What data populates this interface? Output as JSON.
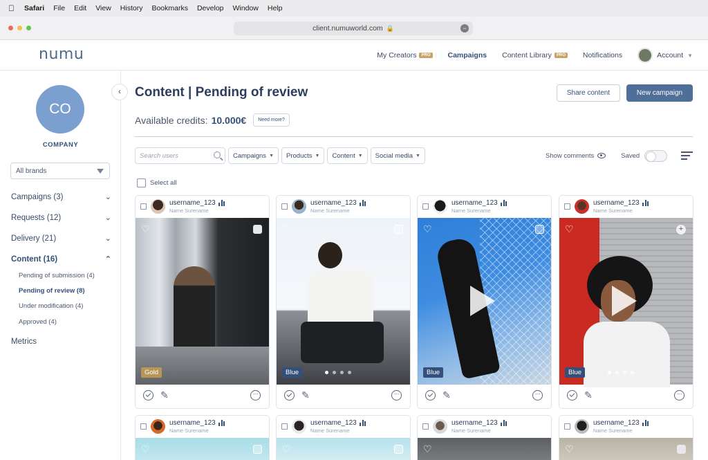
{
  "mac_menu": [
    "Safari",
    "File",
    "Edit",
    "View",
    "History",
    "Bookmarks",
    "Develop",
    "Window",
    "Help"
  ],
  "browser": {
    "url": "client.numuworld.com"
  },
  "nav": {
    "logo": "numu",
    "links": [
      {
        "label": "My Creators",
        "badge": "PRO"
      },
      {
        "label": "Campaigns",
        "badge": ""
      },
      {
        "label": "Content Library",
        "badge": "PRO"
      },
      {
        "label": "Notifications",
        "badge": ""
      }
    ],
    "account": "Account"
  },
  "sidebar": {
    "avatar_initials": "CO",
    "company": "COMPANY",
    "brands_select": "All brands",
    "sections": [
      {
        "label": "Campaigns (3)"
      },
      {
        "label": "Requests (12)"
      },
      {
        "label": "Delivery (21)"
      },
      {
        "label": "Content (16)"
      }
    ],
    "content_sub": [
      "Pending of submission (4)",
      "Pending of review (8)",
      "Under modification (4)",
      "Approved (4)"
    ],
    "metrics": "Metrics"
  },
  "main": {
    "title": "Content | Pending of review",
    "credits_label": "Available credits:",
    "credits_value": "10.000€",
    "need_more": "Need more?",
    "share_button": "Share content",
    "new_campaign_button": "New campaign",
    "search_placeholder": "Search users",
    "filters": [
      "Campaigns",
      "Products",
      "Content",
      "Social media"
    ],
    "show_comments": "Show comments",
    "saved": "Saved",
    "select_all": "Select all"
  },
  "cards": [
    {
      "username": "username_123",
      "name": "Name Surename",
      "tag": "Gold"
    },
    {
      "username": "username_123",
      "name": "Name Surename",
      "tag": "Blue"
    },
    {
      "username": "username_123",
      "name": "Name Surename",
      "tag": "Blue"
    },
    {
      "username": "username_123",
      "name": "Name Surename",
      "tag": "Blue"
    },
    {
      "username": "username_123",
      "name": "Name Surename"
    },
    {
      "username": "username_123",
      "name": "Name Surename"
    },
    {
      "username": "username_123",
      "name": "Name Surename"
    },
    {
      "username": "username_123",
      "name": "Name Surename"
    }
  ],
  "colors": {
    "accent": "#34507a",
    "primary_button": "#4f6e98",
    "avatar": "#7b9fcf",
    "tag_gold": "#b8965a",
    "tag_blue": "#34507a"
  }
}
